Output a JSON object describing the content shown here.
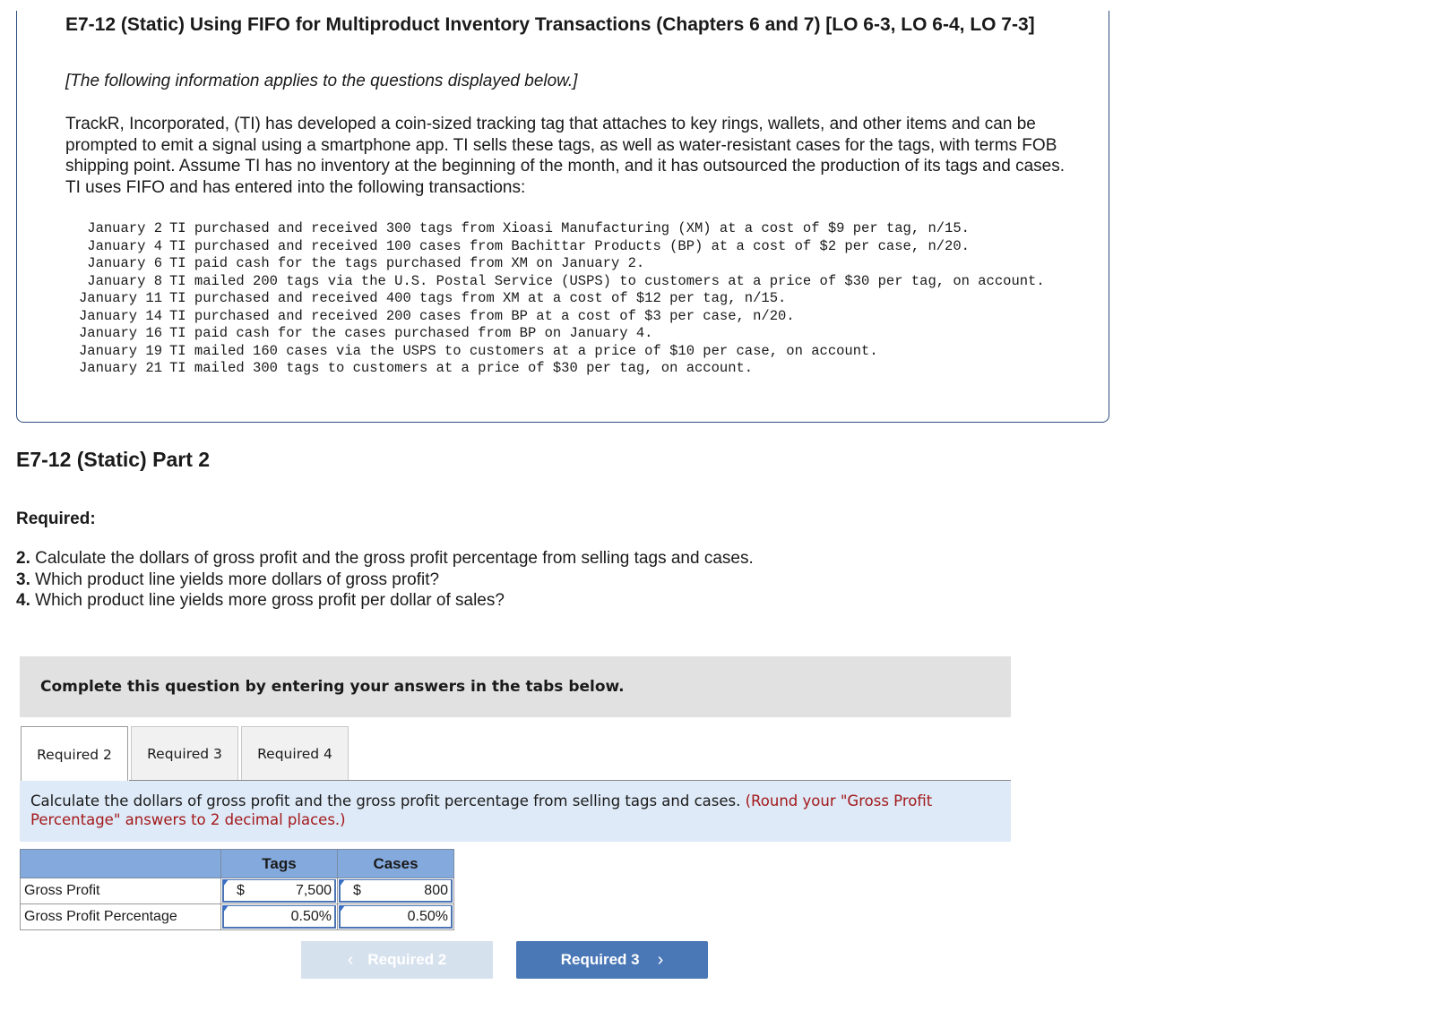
{
  "problem": {
    "title": "E7-12 (Static) Using FIFO for Multiproduct Inventory Transactions (Chapters 6 and 7) [LO 6-3, LO 6-4, LO 7-3]",
    "note": "[The following information applies to the questions displayed below.]",
    "intro": "TrackR, Incorporated, (TI) has developed a coin-sized tracking tag that attaches to key rings, wallets, and other items and can be prompted to emit a signal using a smartphone app. TI sells these tags, as well as water-resistant cases for the tags, with terms FOB shipping point. Assume TI has no inventory at the beginning of the month, and it has outsourced the production of its tags and cases. TI uses FIFO and has entered into the following transactions:",
    "transactions": [
      {
        "date": "January 2",
        "text": "TI purchased and received 300 tags from Xioasi Manufacturing (XM) at a cost of $9 per tag, n/15."
      },
      {
        "date": "January 4",
        "text": "TI purchased and received 100 cases from Bachittar Products (BP) at a cost of $2 per case, n/20."
      },
      {
        "date": "January 6",
        "text": "TI paid cash for the tags purchased from XM on January 2."
      },
      {
        "date": "January 8",
        "text": "TI mailed 200 tags via the U.S. Postal Service (USPS) to customers at a price of $30 per tag, on account."
      },
      {
        "date": "January 11",
        "text": "TI purchased and received 400 tags from XM at a cost of $12 per tag, n/15."
      },
      {
        "date": "January 14",
        "text": "TI purchased and received 200 cases from BP at a cost of $3 per case, n/20."
      },
      {
        "date": "January 16",
        "text": "TI paid cash for the cases purchased from BP on January 4."
      },
      {
        "date": "January 19",
        "text": "TI mailed 160 cases via the USPS to customers at a price of $10 per case, on account."
      },
      {
        "date": "January 21",
        "text": "TI mailed 300 tags to customers at a price of $30 per tag, on account."
      }
    ]
  },
  "part": {
    "title": "E7-12 (Static) Part 2",
    "required_label": "Required:",
    "requirements": [
      {
        "num": "2.",
        "text": " Calculate the dollars of gross profit and the gross profit percentage from selling tags and cases."
      },
      {
        "num": "3.",
        "text": " Which product line yields more dollars of gross profit?"
      },
      {
        "num": "4.",
        "text": " Which product line yields more gross profit per dollar of sales?"
      }
    ]
  },
  "instruction": "Complete this question by entering your answers in the tabs below.",
  "tabs": [
    {
      "label": "Required 2",
      "active": true
    },
    {
      "label": "Required 3",
      "active": false
    },
    {
      "label": "Required 4",
      "active": false
    }
  ],
  "question": {
    "text": "Calculate the dollars of gross profit and the gross profit percentage from selling tags and cases. ",
    "hint": "(Round your \"Gross Profit Percentage\" answers to 2 decimal places.)"
  },
  "answer_table": {
    "headers": [
      "",
      "Tags",
      "Cases"
    ],
    "rows": [
      {
        "label": "Gross Profit",
        "tags_prefix": "$",
        "tags": "7,500",
        "cases_prefix": "$",
        "cases": "800"
      },
      {
        "label": "Gross Profit Percentage",
        "tags": "0.50%",
        "cases": "0.50%"
      }
    ]
  },
  "nav": {
    "prev_label": "Required 2",
    "next_label": "Required 3",
    "prev_icon": "‹",
    "next_icon": "›"
  },
  "colors": {
    "accent": "#4a77b6",
    "hint_red": "#a3191b",
    "table_header": "#84aadd",
    "panel_bg": "#deeaf7"
  }
}
